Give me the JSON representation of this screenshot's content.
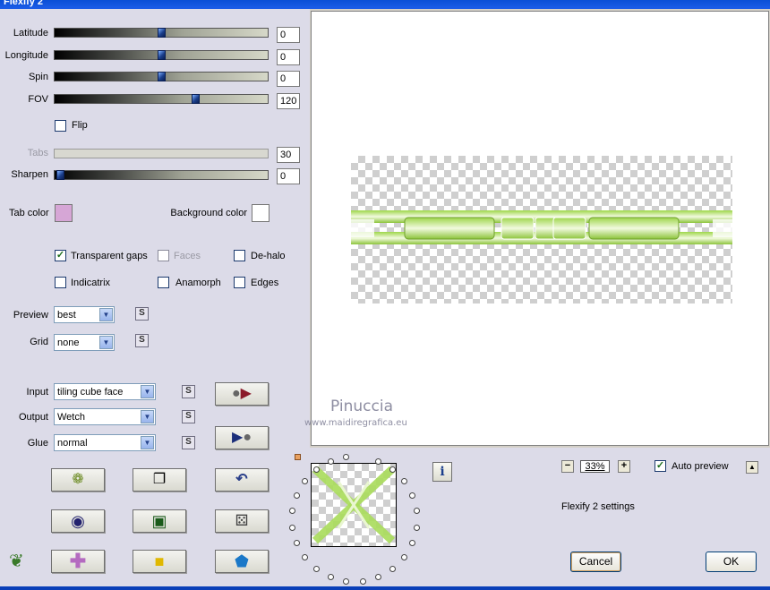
{
  "window": {
    "title": "Flexify 2"
  },
  "sliders": [
    {
      "label": "Latitude",
      "value": "0",
      "position": 0.5
    },
    {
      "label": "Longitude",
      "value": "0",
      "position": 0.5
    },
    {
      "label": "Spin",
      "value": "0",
      "position": 0.5
    },
    {
      "label": "FOV",
      "value": "120",
      "position": 0.66
    },
    {
      "label": "Tabs",
      "value": "30",
      "position": null
    },
    {
      "label": "Sharpen",
      "value": "0",
      "position": 0
    }
  ],
  "flip": {
    "label": "Flip",
    "checked": false
  },
  "colors": {
    "tab_color_label": "Tab color",
    "tab_color": "#d6a6d6",
    "background_color_label": "Background color",
    "background_color": "#ffffff"
  },
  "options": {
    "transparent_gaps": {
      "label": "Transparent gaps",
      "checked": true
    },
    "faces": {
      "label": "Faces",
      "checked": false
    },
    "de_halo": {
      "label": "De-halo",
      "checked": false
    },
    "indicatrix": {
      "label": "Indicatrix",
      "checked": false
    },
    "anamorph": {
      "label": "Anamorph",
      "checked": false
    },
    "edges": {
      "label": "Edges",
      "checked": false
    }
  },
  "preview_select": {
    "label": "Preview",
    "value": "best",
    "s_button": "S"
  },
  "grid_select": {
    "label": "Grid",
    "value": "none",
    "s_button": "S"
  },
  "input_select": {
    "label": "Input",
    "value": "tiling cube face",
    "s_button": "S"
  },
  "output_select": {
    "label": "Output",
    "value": "Wetch",
    "s_button": "S"
  },
  "glue_select": {
    "label": "Glue",
    "value": "normal",
    "s_button": "S"
  },
  "tool_icons": [
    "gear-ball-icon",
    "copy-page-icon",
    "undo-arrow-icon",
    "ring-icon",
    "square-frame-icon",
    "dice-icon",
    "plus-cross-icon",
    "cube-icon",
    "pentagon-gem-icon"
  ],
  "watermark": {
    "name": "Pinuccia",
    "url": "www.maidiregrafica.eu"
  },
  "zoom": {
    "minus": "−",
    "value": "33%",
    "plus": "+"
  },
  "auto_preview": {
    "label": "Auto preview",
    "checked": true,
    "arrow": "▲"
  },
  "info_button": "i",
  "settings_text": "Flexify 2 settings",
  "buttons": {
    "cancel": "Cancel",
    "ok": "OK"
  },
  "accent": {
    "green": "#9ed64a",
    "xp_blue": "#0a4fd6"
  }
}
